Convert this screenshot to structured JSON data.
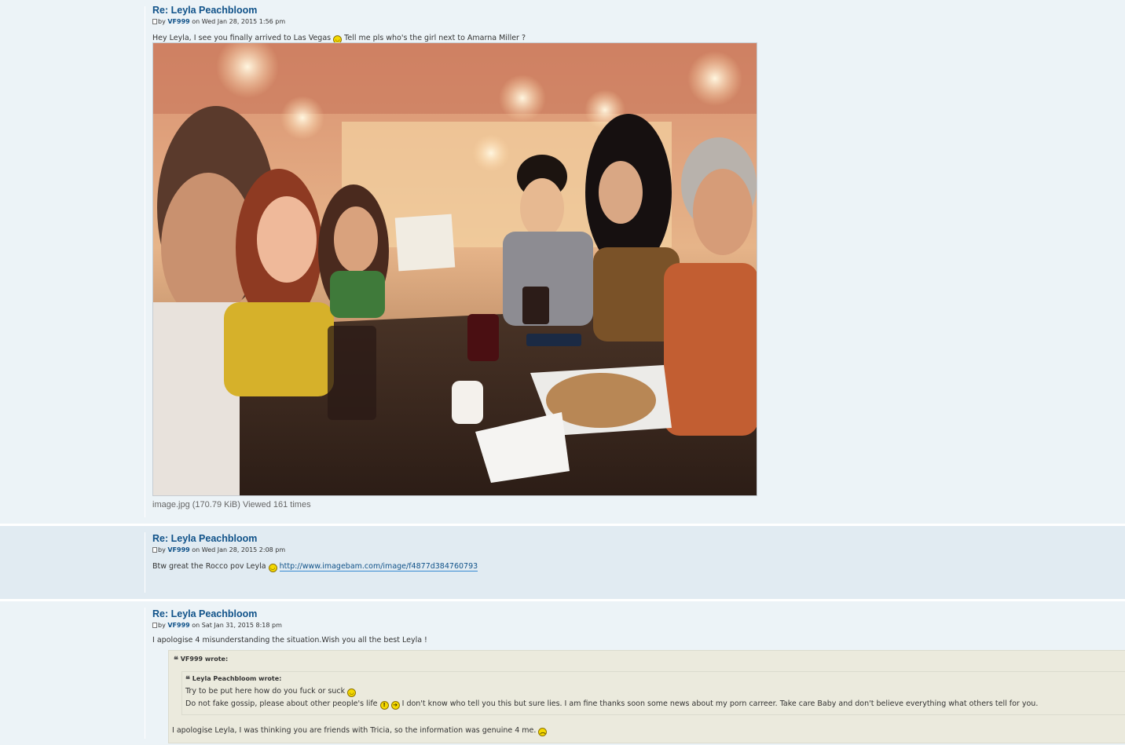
{
  "posts": [
    {
      "title": "Re: Leyla Peachbloom",
      "author": {
        "prefix": "by",
        "name": "VF999",
        "date": "on Wed Jan 28, 2015 1:56 pm"
      },
      "content": {
        "text1": "Hey Leyla, I see you finally arrived to Las Vegas",
        "text2": "Tell me pls who's the girl next to Amarna Miller ?"
      },
      "attachment": {
        "filename": "image.jpg",
        "info": "(170.79 KiB) Viewed 161 times"
      }
    },
    {
      "title": "Re: Leyla Peachbloom",
      "author": {
        "prefix": "by",
        "name": "VF999",
        "date": "on Wed Jan 28, 2015 2:08 pm"
      },
      "content": {
        "text1": "Btw great the Rocco pov Leyla",
        "link": "http://www.imagebam.com/image/f4877d384760793"
      }
    },
    {
      "title": "Re: Leyla Peachbloom",
      "author": {
        "prefix": "by",
        "name": "VF999",
        "date": "on Sat Jan 31, 2015 8:18 pm"
      },
      "content": {
        "text1": "I apologise 4 misunderstanding the situation.Wish you all the best Leyla !",
        "quote": {
          "cite": "VF999 wrote:",
          "inner": {
            "cite": "Leyla Peachbloom wrote:",
            "line1": "Try to be put here how do you fuck or suck",
            "line2a": "Do not fake gossip, please about other people's life",
            "line2b": "I don't know who tell you this but sure lies. I am fine thanks soon some news about my porn carreer. Take care Baby and don't believe everything what others tell for you."
          },
          "after": "I apologise Leyla, I was thinking you are friends with Tricia, so the information was genuine 4 me."
        }
      }
    }
  ],
  "smilies": {
    "smile": "smile-icon",
    "wink": "wink-icon",
    "exclaim": "exclaim-icon",
    "arrow": "arrow-icon",
    "sad": "sad-icon"
  },
  "colors": {
    "post_bg": "#ecf3f7",
    "post_bg_alt": "#e1ebf2",
    "link": "#105289",
    "quote_bg": "#ebeadd"
  }
}
